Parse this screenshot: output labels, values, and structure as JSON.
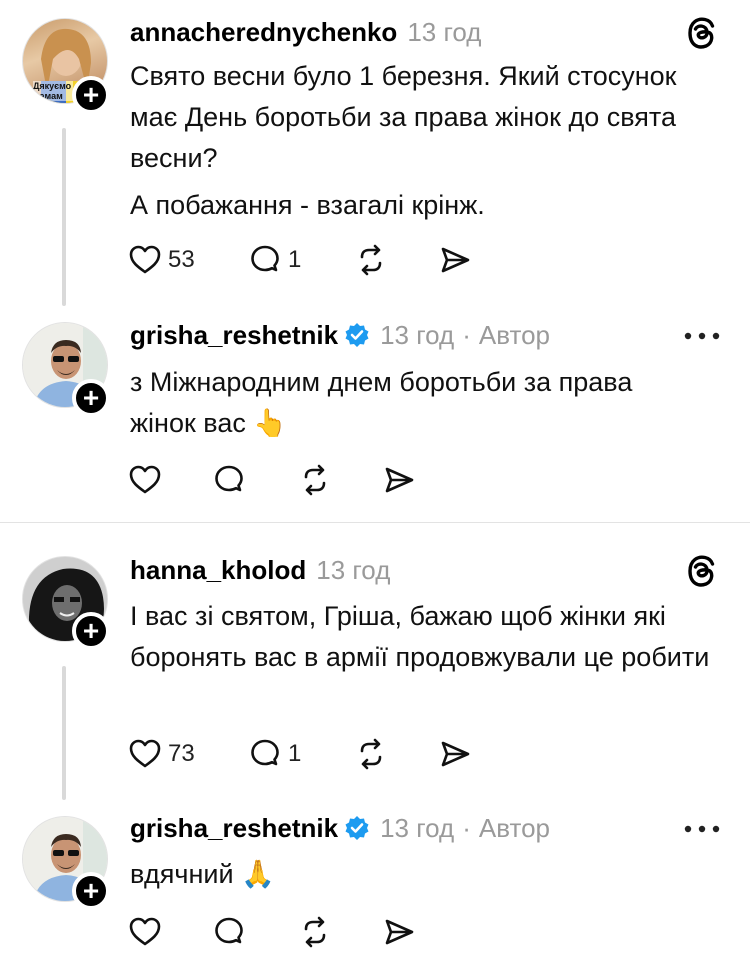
{
  "threads": [
    {
      "comment": {
        "username": "annacherednychenko",
        "time": "13 год",
        "avatar_text": "Дякуємо мамам",
        "paragraphs": [
          "Свято весни було 1 березня. Який стосунок має День боротьби за права жінок до свята весни?",
          "А побажання - взагалі крінж."
        ],
        "likes": "53",
        "replies": "1",
        "top_icon": "threads-logo-icon"
      },
      "reply": {
        "username": "grisha_reshetnik",
        "verified": true,
        "time": "13 год",
        "separator": "·",
        "author_label": "Автор",
        "text": "з Міжнародним днем боротьби за права жінок вас 👆",
        "top_icon": "more-icon"
      }
    },
    {
      "comment": {
        "username": "hanna_kholod",
        "time": "13 год",
        "paragraphs": [
          "І вас зі святом, Гріша, бажаю щоб жінки які боронять вас в армії продовжували це робити"
        ],
        "likes": "73",
        "replies": "1",
        "top_icon": "threads-logo-icon"
      },
      "reply": {
        "username": "grisha_reshetnik",
        "verified": true,
        "time": "13 год",
        "separator": "·",
        "author_label": "Автор",
        "text": "вдячний 🙏",
        "top_icon": "more-icon"
      }
    }
  ],
  "colors": {
    "verified": "#1d9bf0",
    "muted": "#9a9a9a",
    "thread_line": "#d9d9d9"
  }
}
